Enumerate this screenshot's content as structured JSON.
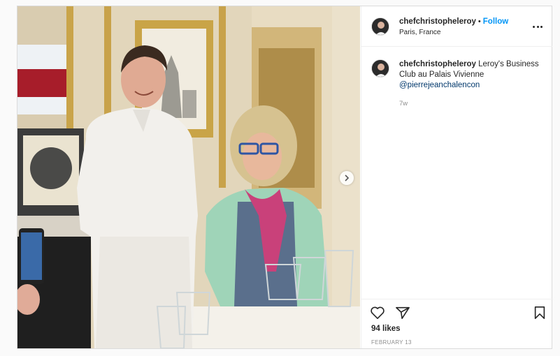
{
  "post": {
    "username": "chefchristopheleroy",
    "follow_label": "Follow",
    "separator": "•",
    "location": "Paris, France",
    "caption_text": " Leroy's Business Club au Palais Vivienne",
    "mention": "@pierrejeanchalencon",
    "time_ago": "7w",
    "likes": "94 likes",
    "date": "FEBRUARY 13"
  },
  "icons": {
    "more": "more-options-icon",
    "next": "chevron-right-icon",
    "like": "heart-icon",
    "share": "paper-plane-icon",
    "save": "bookmark-icon"
  },
  "colors": {
    "link_blue": "#0095f6",
    "mention_blue": "#00376b",
    "muted_gray": "#8e8e8e"
  }
}
